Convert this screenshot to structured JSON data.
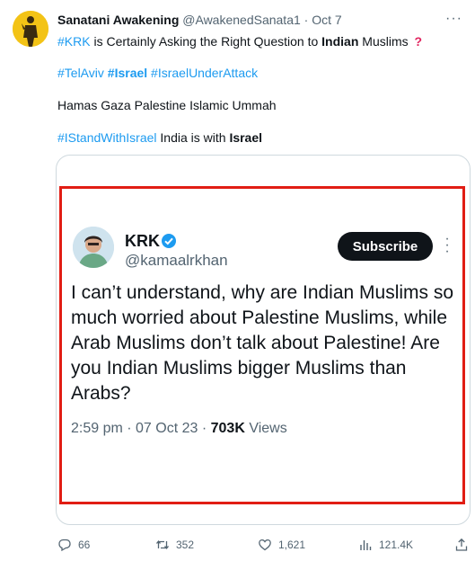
{
  "tweet": {
    "author_name": "Sanatani Awakening",
    "author_handle": "@AwakenedSanata1",
    "separator": "·",
    "time": "Oct 7",
    "line1": {
      "tag": "#KRK",
      "text_a": " is Certainly Asking the Right Question to ",
      "bold": "Indian",
      "text_b": " Muslims ",
      "emoji": "?"
    },
    "line2": {
      "tags": [
        "#TelAviv",
        "#Israel",
        "#IsraelUnderAttack"
      ]
    },
    "line3": "Hamas Gaza Palestine Islamic Ummah",
    "line4": {
      "tag": "#IStandWithIsrael",
      "text": " India is with ",
      "bold": "Israel"
    }
  },
  "quoted": {
    "name": "KRK",
    "handle": "@kamaalrkhan",
    "subscribe_label": "Subscribe",
    "text": "I can’t understand, why are Indian Muslims so much worried about Palestine Muslims, while Arab Muslims don’t talk about Palestine! Are you Indian Muslims bigger Muslims than Arabs?",
    "time": "2:59 pm",
    "separator": " · ",
    "date": "07 Oct 23",
    "views_count": "703K",
    "views_label": " Views"
  },
  "actions": {
    "replies": "66",
    "retweets": "352",
    "likes": "1,621",
    "views": "121.4K"
  },
  "colors": {
    "accent": "#1d9bf0",
    "highlight_border": "#e11d14",
    "muted": "#536471"
  }
}
